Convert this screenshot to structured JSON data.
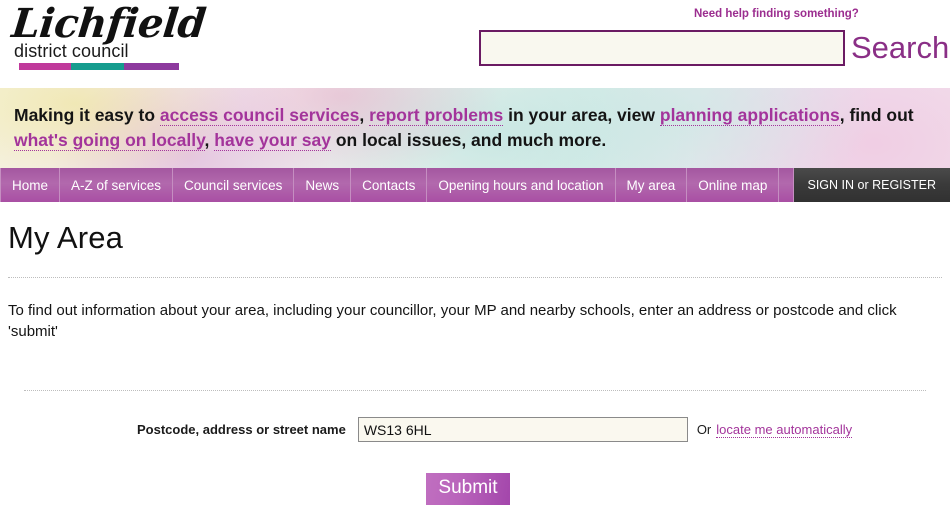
{
  "header": {
    "logo": {
      "script_text": "Lichfield",
      "sub_text": "district council",
      "bar_colors": [
        "#c0399b",
        "#159c8e",
        "#8d3a9e"
      ]
    },
    "help_link": "Need help finding something?",
    "search": {
      "value": "",
      "placeholder": "",
      "button_label": "Search"
    }
  },
  "strapline": {
    "part1": "Making it easy to ",
    "link1": "access council services",
    "part2": ", ",
    "link2": "report problems",
    "part3": " in your area, view ",
    "link3": "planning applications",
    "part4": ", find out ",
    "link4": "what's going on locally",
    "part5": ", ",
    "link5": "have your say",
    "part6": " on local issues, and much more."
  },
  "nav": {
    "items": [
      {
        "label": "Home"
      },
      {
        "label": "A-Z of services"
      },
      {
        "label": "Council services"
      },
      {
        "label": "News"
      },
      {
        "label": "Contacts"
      },
      {
        "label": "Opening hours and location"
      },
      {
        "label": "My area"
      },
      {
        "label": "Online map"
      }
    ],
    "signin_label": "SIGN IN or REGISTER"
  },
  "main": {
    "title": "My Area",
    "intro": "To find out information about your area, including your councillor, your MP and nearby schools, enter an address or postcode and click 'submit'",
    "form": {
      "label": "Postcode, address or street name",
      "postcode_value": "WS13 6HL",
      "postcode_placeholder": "",
      "or_text": "Or",
      "locate_link": "locate me automatically",
      "submit_label": "Submit"
    }
  },
  "colors": {
    "brand_purple": "#8a2f86",
    "link_purple": "#a3349b",
    "nav_purple": "#b269ad",
    "signin_dark": "#3a3a3a",
    "input_cream": "#faf8ef"
  }
}
